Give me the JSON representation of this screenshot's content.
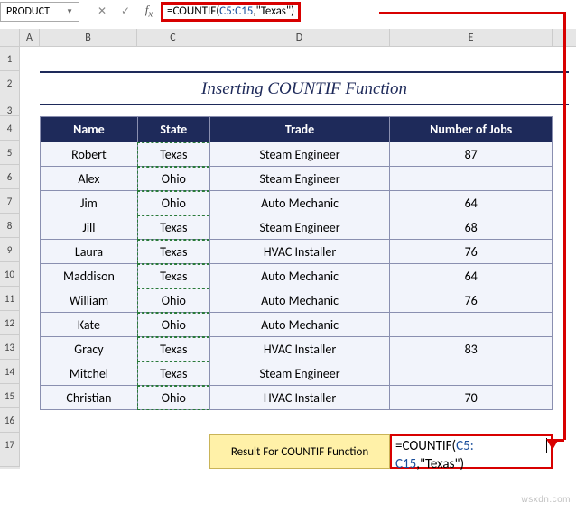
{
  "namebox": {
    "value": "PRODUCT"
  },
  "formula_bar": {
    "prefix": "=COUNTIF(",
    "range": "C5:C15",
    "suffix": ",\"Texas\")"
  },
  "columns": {
    "A": "A",
    "B": "B",
    "C": "C",
    "D": "D",
    "E": "E"
  },
  "rows": [
    "1",
    "2",
    "3",
    "4",
    "5",
    "6",
    "7",
    "8",
    "9",
    "10",
    "11",
    "12",
    "13",
    "14",
    "15",
    "16",
    "17"
  ],
  "title": "Inserting COUNTIF Function",
  "headers": {
    "name": "Name",
    "state": "State",
    "trade": "Trade",
    "jobs": "Number of Jobs"
  },
  "table": [
    {
      "name": "Robert",
      "state": "Texas",
      "trade": "Steam Engineer",
      "jobs": "87"
    },
    {
      "name": "Alex",
      "state": "Ohio",
      "trade": "Steam Engineer",
      "jobs": ""
    },
    {
      "name": "Jim",
      "state": "Ohio",
      "trade": "Auto Mechanic",
      "jobs": "64"
    },
    {
      "name": "Jill",
      "state": "Texas",
      "trade": "Steam Engineer",
      "jobs": "68"
    },
    {
      "name": "Laura",
      "state": "Texas",
      "trade": "HVAC Installer",
      "jobs": "76"
    },
    {
      "name": "Maddison",
      "state": "Texas",
      "trade": "Auto Mechanic",
      "jobs": "64"
    },
    {
      "name": "William",
      "state": "Ohio",
      "trade": "Auto Mechanic",
      "jobs": "76"
    },
    {
      "name": "Kate",
      "state": "Ohio",
      "trade": "Auto Mechanic",
      "jobs": ""
    },
    {
      "name": "Gracy",
      "state": "Texas",
      "trade": "HVAC Installer",
      "jobs": "83"
    },
    {
      "name": "Mitchel",
      "state": "Texas",
      "trade": "Steam Engineer",
      "jobs": ""
    },
    {
      "name": "Christian",
      "state": "Ohio",
      "trade": "HVAC Installer",
      "jobs": "70"
    }
  ],
  "result_label": "Result For COUNTIF Function",
  "result_formula": {
    "p1": "=COUNTIF(",
    "p2": "C5:",
    "p3": "C15",
    "p4": ",\"Texas\")"
  },
  "watermark": "wsxdn.com"
}
